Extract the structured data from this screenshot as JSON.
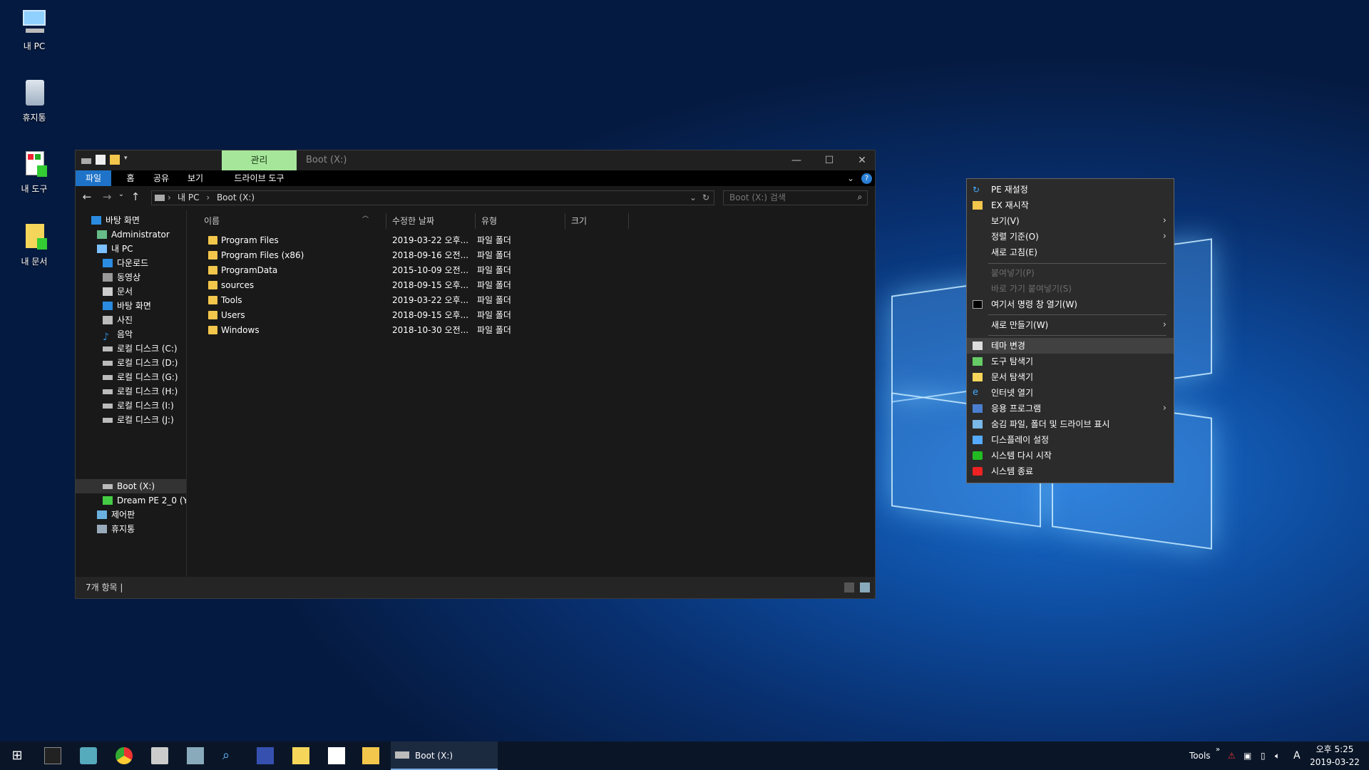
{
  "desktop": {
    "icons": [
      {
        "label": "내 PC"
      },
      {
        "label": "휴지통"
      },
      {
        "label": "내 도구"
      },
      {
        "label": "내 문서"
      }
    ]
  },
  "explorer": {
    "context_tab": "관리",
    "title": "Boot (X:)",
    "ribbon_tabs": [
      "파일",
      "홈",
      "공유",
      "보기",
      "드라이브 도구"
    ],
    "breadcrumb": [
      "내 PC",
      "Boot (X:)"
    ],
    "search_placeholder": "Boot (X:) 검색",
    "tree": [
      "바탕 화면",
      "Administrator",
      "내 PC",
      "다운로드",
      "동영상",
      "문서",
      "바탕 화면",
      "사진",
      "음악",
      "로컬 디스크 (C:)",
      "로컬 디스크 (D:)",
      "로컬 디스크 (G:)",
      "로컬 디스크 (H:)",
      "로컬 디스크 (I:)",
      "로컬 디스크 (J:)",
      "Boot (X:)",
      "Dream PE 2_0 (Y:",
      "제어판",
      "휴지통"
    ],
    "columns": [
      "이름",
      "수정한 날짜",
      "유형",
      "크기"
    ],
    "rows": [
      {
        "name": "Program Files",
        "date": "2019-03-22 오후...",
        "type": "파일 폴더"
      },
      {
        "name": "Program Files (x86)",
        "date": "2018-09-16 오전...",
        "type": "파일 폴더"
      },
      {
        "name": "ProgramData",
        "date": "2015-10-09 오전...",
        "type": "파일 폴더"
      },
      {
        "name": "sources",
        "date": "2018-09-15 오후...",
        "type": "파일 폴더"
      },
      {
        "name": "Tools",
        "date": "2019-03-22 오후...",
        "type": "파일 폴더"
      },
      {
        "name": "Users",
        "date": "2018-09-15 오후...",
        "type": "파일 폴더"
      },
      {
        "name": "Windows",
        "date": "2018-10-30 오전...",
        "type": "파일 폴더"
      }
    ],
    "status": "7개 항목  |"
  },
  "context_menu": [
    {
      "label": "PE 재설정"
    },
    {
      "label": "EX 재시작"
    },
    {
      "label": "보기(V)"
    },
    {
      "label": "정렬 기준(O)"
    },
    {
      "label": "새로 고침(E)"
    },
    {
      "label": "붙여넣기(P)"
    },
    {
      "label": "바로 가기 붙여넣기(S)"
    },
    {
      "label": "여기서 명령 창 열기(W)"
    },
    {
      "label": "새로 만들기(W)"
    },
    {
      "label": "테마 변경"
    },
    {
      "label": "도구 탐색기"
    },
    {
      "label": "문서 탐색기"
    },
    {
      "label": "인터넷 열기"
    },
    {
      "label": "응용 프로그램"
    },
    {
      "label": "숨김 파일, 폴더 및 드라이브 표시"
    },
    {
      "label": "디스플레이 설정"
    },
    {
      "label": "시스템 다시 시작"
    },
    {
      "label": "시스템 종료"
    }
  ],
  "taskbar": {
    "active_window": "Boot (X:)",
    "tools_label": "Tools",
    "time": "오후 5:25",
    "date": "2019-03-22"
  }
}
